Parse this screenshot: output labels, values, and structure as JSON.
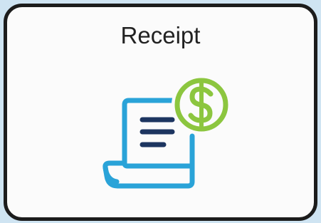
{
  "tile": {
    "title": "Receipt",
    "icon": "receipt-dollar-icon"
  },
  "colors": {
    "background": "#cfe4f2",
    "tile_fill": "#fbfbfb",
    "tile_border": "#1c1c1c",
    "receipt_outline": "#2aa3d8",
    "text_lines": "#1d3560",
    "dollar_badge": "#8cc63f"
  }
}
